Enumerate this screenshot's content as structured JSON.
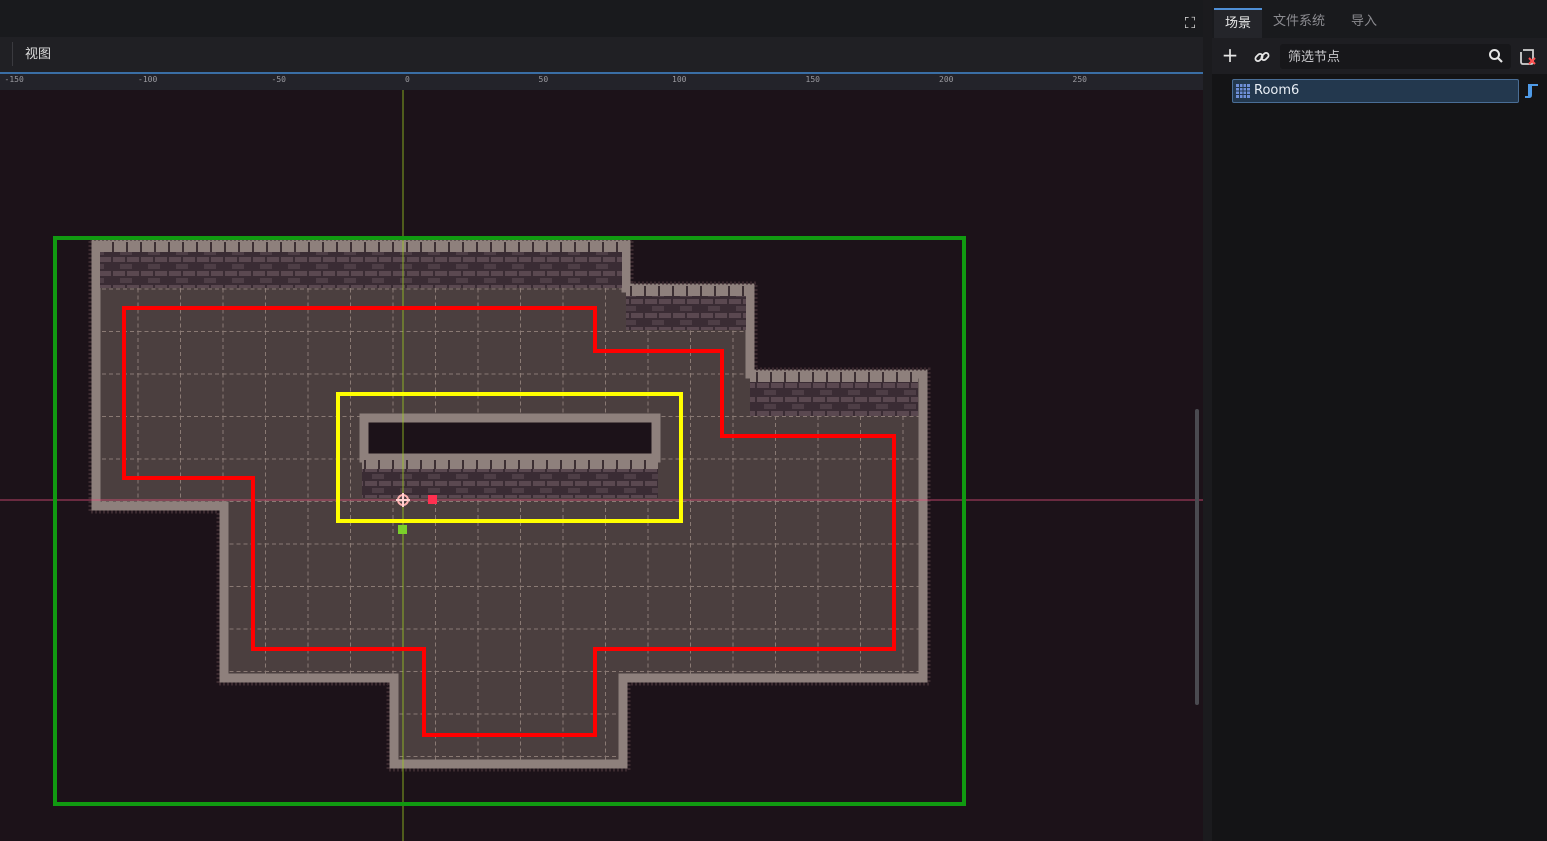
{
  "editor": {
    "view_menu": "视图",
    "ruler_labels": [
      "-150",
      "-100",
      "-50",
      "0",
      "50",
      "100",
      "150",
      "200",
      "250"
    ],
    "colors": {
      "viewport_bg": "#1c1219",
      "camera_limits": "#119a11",
      "navigation_polygon": "#ff0000",
      "selection_box": "#ffff00",
      "floor": "#4a3e3e",
      "wall": "#8a7a78"
    }
  },
  "dock": {
    "tabs": [
      {
        "label": "场景",
        "active": true
      },
      {
        "label": "文件系统",
        "active": false
      },
      {
        "label": "导入",
        "active": false
      }
    ],
    "filter_placeholder": "筛选节点",
    "tree": [
      {
        "name": "Room6",
        "icon": "tilemap-icon",
        "has_script": true,
        "selected": true
      }
    ]
  },
  "icons": {
    "fullscreen": "fullscreen-icon",
    "add": "plus-icon",
    "link": "link-icon",
    "search": "search-icon",
    "script": "script-icon"
  }
}
